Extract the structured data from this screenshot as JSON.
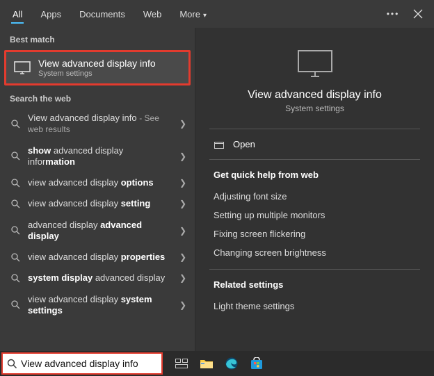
{
  "tabs": {
    "all": "All",
    "apps": "Apps",
    "documents": "Documents",
    "web": "Web",
    "more": "More"
  },
  "left": {
    "best_label": "Best match",
    "best_title": "View advanced display info",
    "best_sub": "System settings",
    "web_label": "Search the web",
    "items": [
      {
        "html": "View advanced display info <span class='dim'>- See web results</span>"
      },
      {
        "html": "<b>show</b> advanced display infor<b>mation</b>"
      },
      {
        "html": "view advanced display <b>options</b>"
      },
      {
        "html": "view advanced display <b>setting</b>"
      },
      {
        "html": "advanced display <b>advanced display</b>"
      },
      {
        "html": "view advanced display <b>properties</b>"
      },
      {
        "html": "<b>system display</b> advanced display"
      },
      {
        "html": "view advanced display <b>system settings</b>"
      }
    ]
  },
  "right": {
    "title": "View advanced display info",
    "sub": "System settings",
    "open": "Open",
    "quick_heading": "Get quick help from web",
    "quick_links": [
      "Adjusting font size",
      "Setting up multiple monitors",
      "Fixing screen flickering",
      "Changing screen brightness"
    ],
    "related_heading": "Related settings",
    "related_links": [
      "Light theme settings"
    ]
  },
  "search": {
    "value": "View advanced display info"
  }
}
